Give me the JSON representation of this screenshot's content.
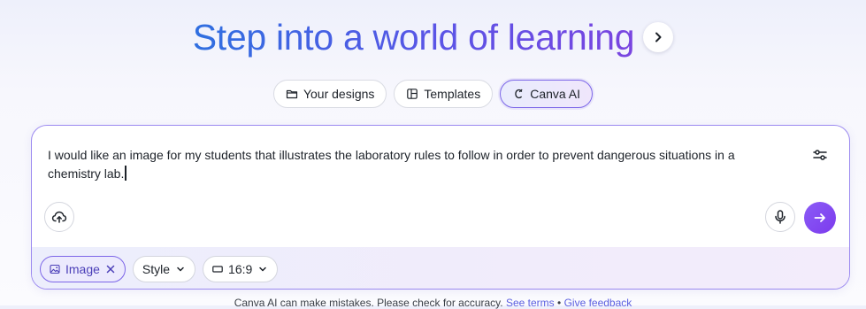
{
  "hero": {
    "title": "Step into a world of learning"
  },
  "tabs": [
    {
      "label": "Your designs",
      "icon": "folder-icon",
      "active": false
    },
    {
      "label": "Templates",
      "icon": "template-icon",
      "active": false
    },
    {
      "label": "Canva AI",
      "icon": "canva-ai-icon",
      "active": true
    }
  ],
  "prompt": {
    "text": "I would like an image for my students that illustrates the laboratory rules to follow in order to prevent dangerous situations in a chemistry lab."
  },
  "options": {
    "type_label": "Image",
    "style_label": "Style",
    "ratio_label": "16:9"
  },
  "footer": {
    "disclaimer": "Canva AI can make mistakes. Please check for accuracy.",
    "terms_link": "See terms",
    "separator": "•",
    "feedback_link": "Give feedback"
  },
  "colors": {
    "accent": "#7c3aed",
    "title_gradient_start": "#2f6fe0",
    "title_gradient_end": "#7a45e0",
    "link": "#5b5fe0"
  }
}
